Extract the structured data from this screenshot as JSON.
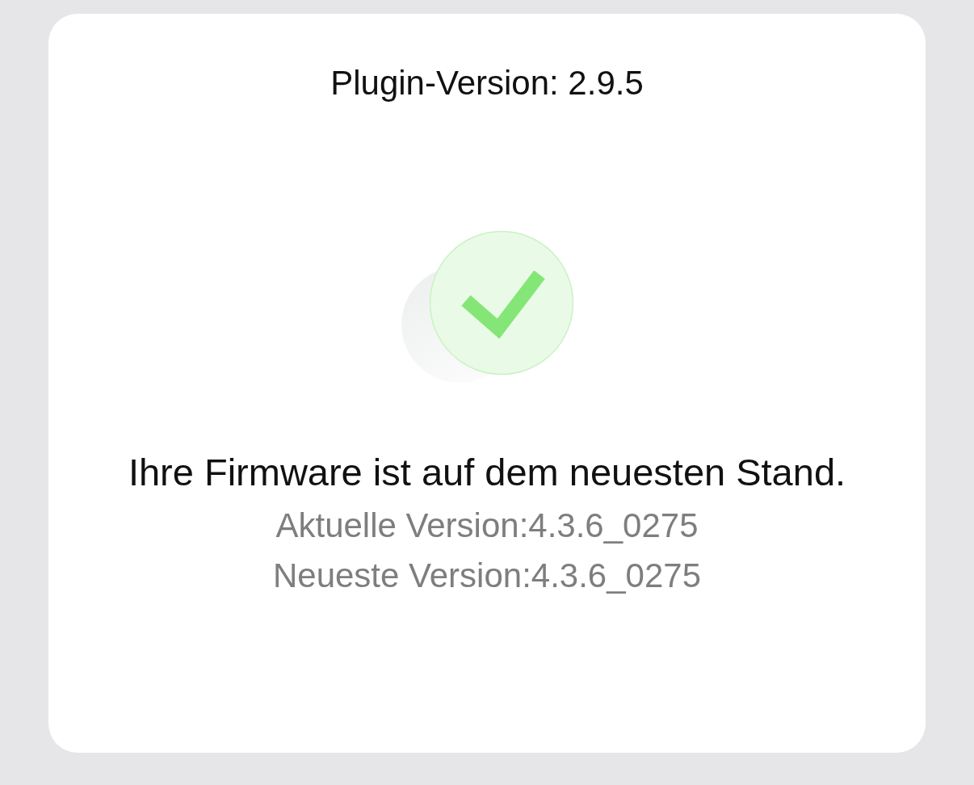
{
  "header": {
    "plugin_version": "Plugin-Version: 2.9.5"
  },
  "status": {
    "kind": "up_to_date",
    "title": "Ihre Firmware ist auf dem neuesten Stand.",
    "lines": [
      "Aktuelle Version:4.3.6_0275",
      "Neueste Version:4.3.6_0275"
    ]
  }
}
